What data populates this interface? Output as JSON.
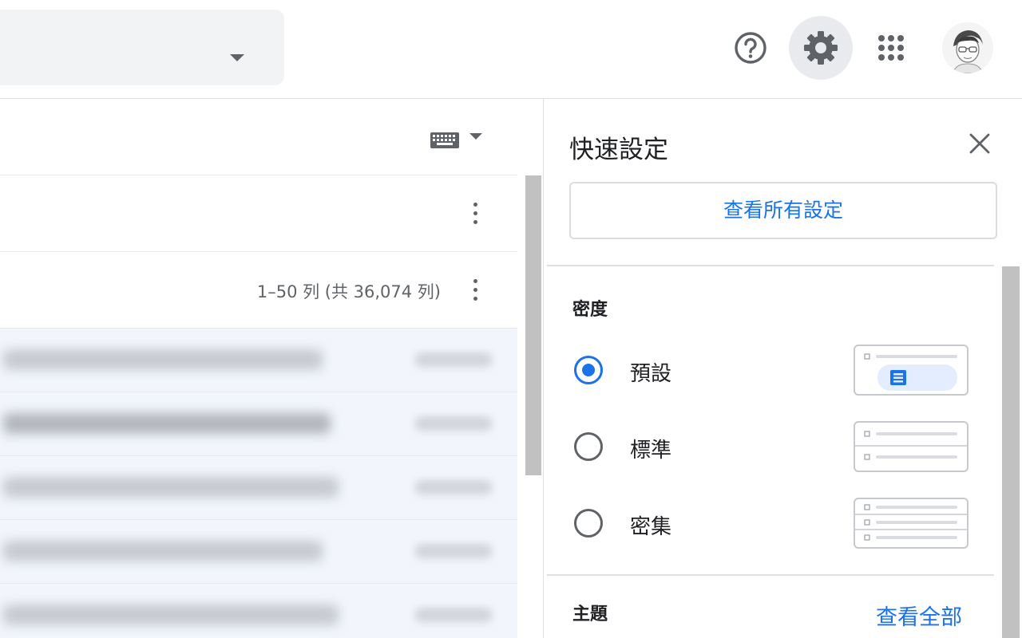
{
  "topbar": {
    "search": {
      "options_icon": "caret-down-icon"
    },
    "help": {
      "icon": "help-circle-icon"
    },
    "settings": {
      "icon": "gear-icon"
    },
    "apps": {
      "icon": "apps-grid-icon"
    },
    "account": {
      "icon": "avatar"
    }
  },
  "mail_list": {
    "input_tools_icon": "keyboard-icon",
    "page_count": "1–50 列 (共 36,074 列)",
    "row_count": 5
  },
  "quick_settings": {
    "title": "快速設定",
    "all_settings_label": "查看所有設定",
    "density": {
      "label": "密度",
      "options": [
        {
          "label": "預設",
          "selected": true
        },
        {
          "label": "標準",
          "selected": false
        },
        {
          "label": "密集",
          "selected": false
        }
      ]
    },
    "theme": {
      "label": "主題",
      "view_all_label": "查看全部"
    }
  },
  "colors": {
    "accent": "#1a73e8",
    "icon_gray": "#5f6368",
    "divider": "#e0e0e0",
    "selected_bg": "#e8eaed",
    "row_bg": "#f2f6fc"
  }
}
